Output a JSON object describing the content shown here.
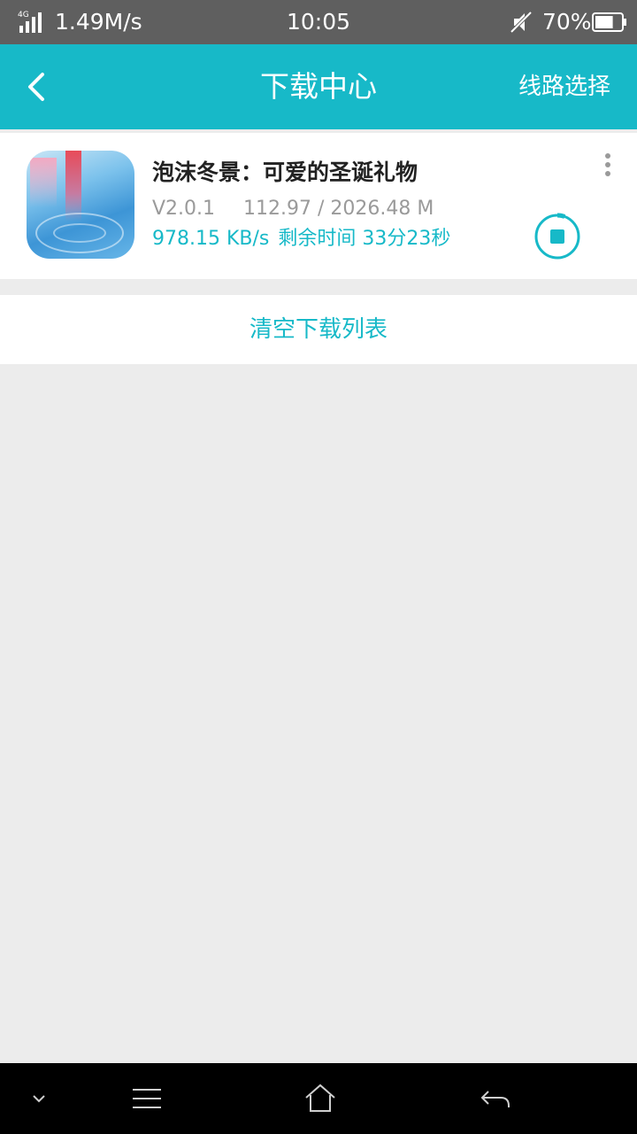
{
  "status_bar": {
    "network": "4G",
    "speed": "1.49M/s",
    "time": "10:05",
    "battery": "70%",
    "battery_level": 0.7,
    "icons": [
      "signal-icon",
      "mute-icon",
      "battery-icon"
    ]
  },
  "header": {
    "back_icon": "back-arrow-icon",
    "title": "下载中心",
    "route_label": "线路选择"
  },
  "downloads": [
    {
      "name": "泡沫冬景：可爱的圣诞礼物",
      "version": "V2.0.1",
      "progress": "112.97 / 2026.48 M",
      "speed": "978.15 KB/s",
      "remaining": "剩余时间 33分23秒",
      "progress_fraction": 0.0557,
      "icons": [
        "app-icon",
        "more-vertical-icon",
        "stop-icon"
      ]
    }
  ],
  "actions": {
    "clear_label": "清空下载列表"
  },
  "nav_bar": {
    "icons": [
      "chevron-down-icon",
      "menu-icon",
      "home-icon",
      "return-icon"
    ]
  },
  "colors": {
    "accent": "#17b9c8",
    "status_bar": "#5f5f5f",
    "background": "#ececec"
  }
}
